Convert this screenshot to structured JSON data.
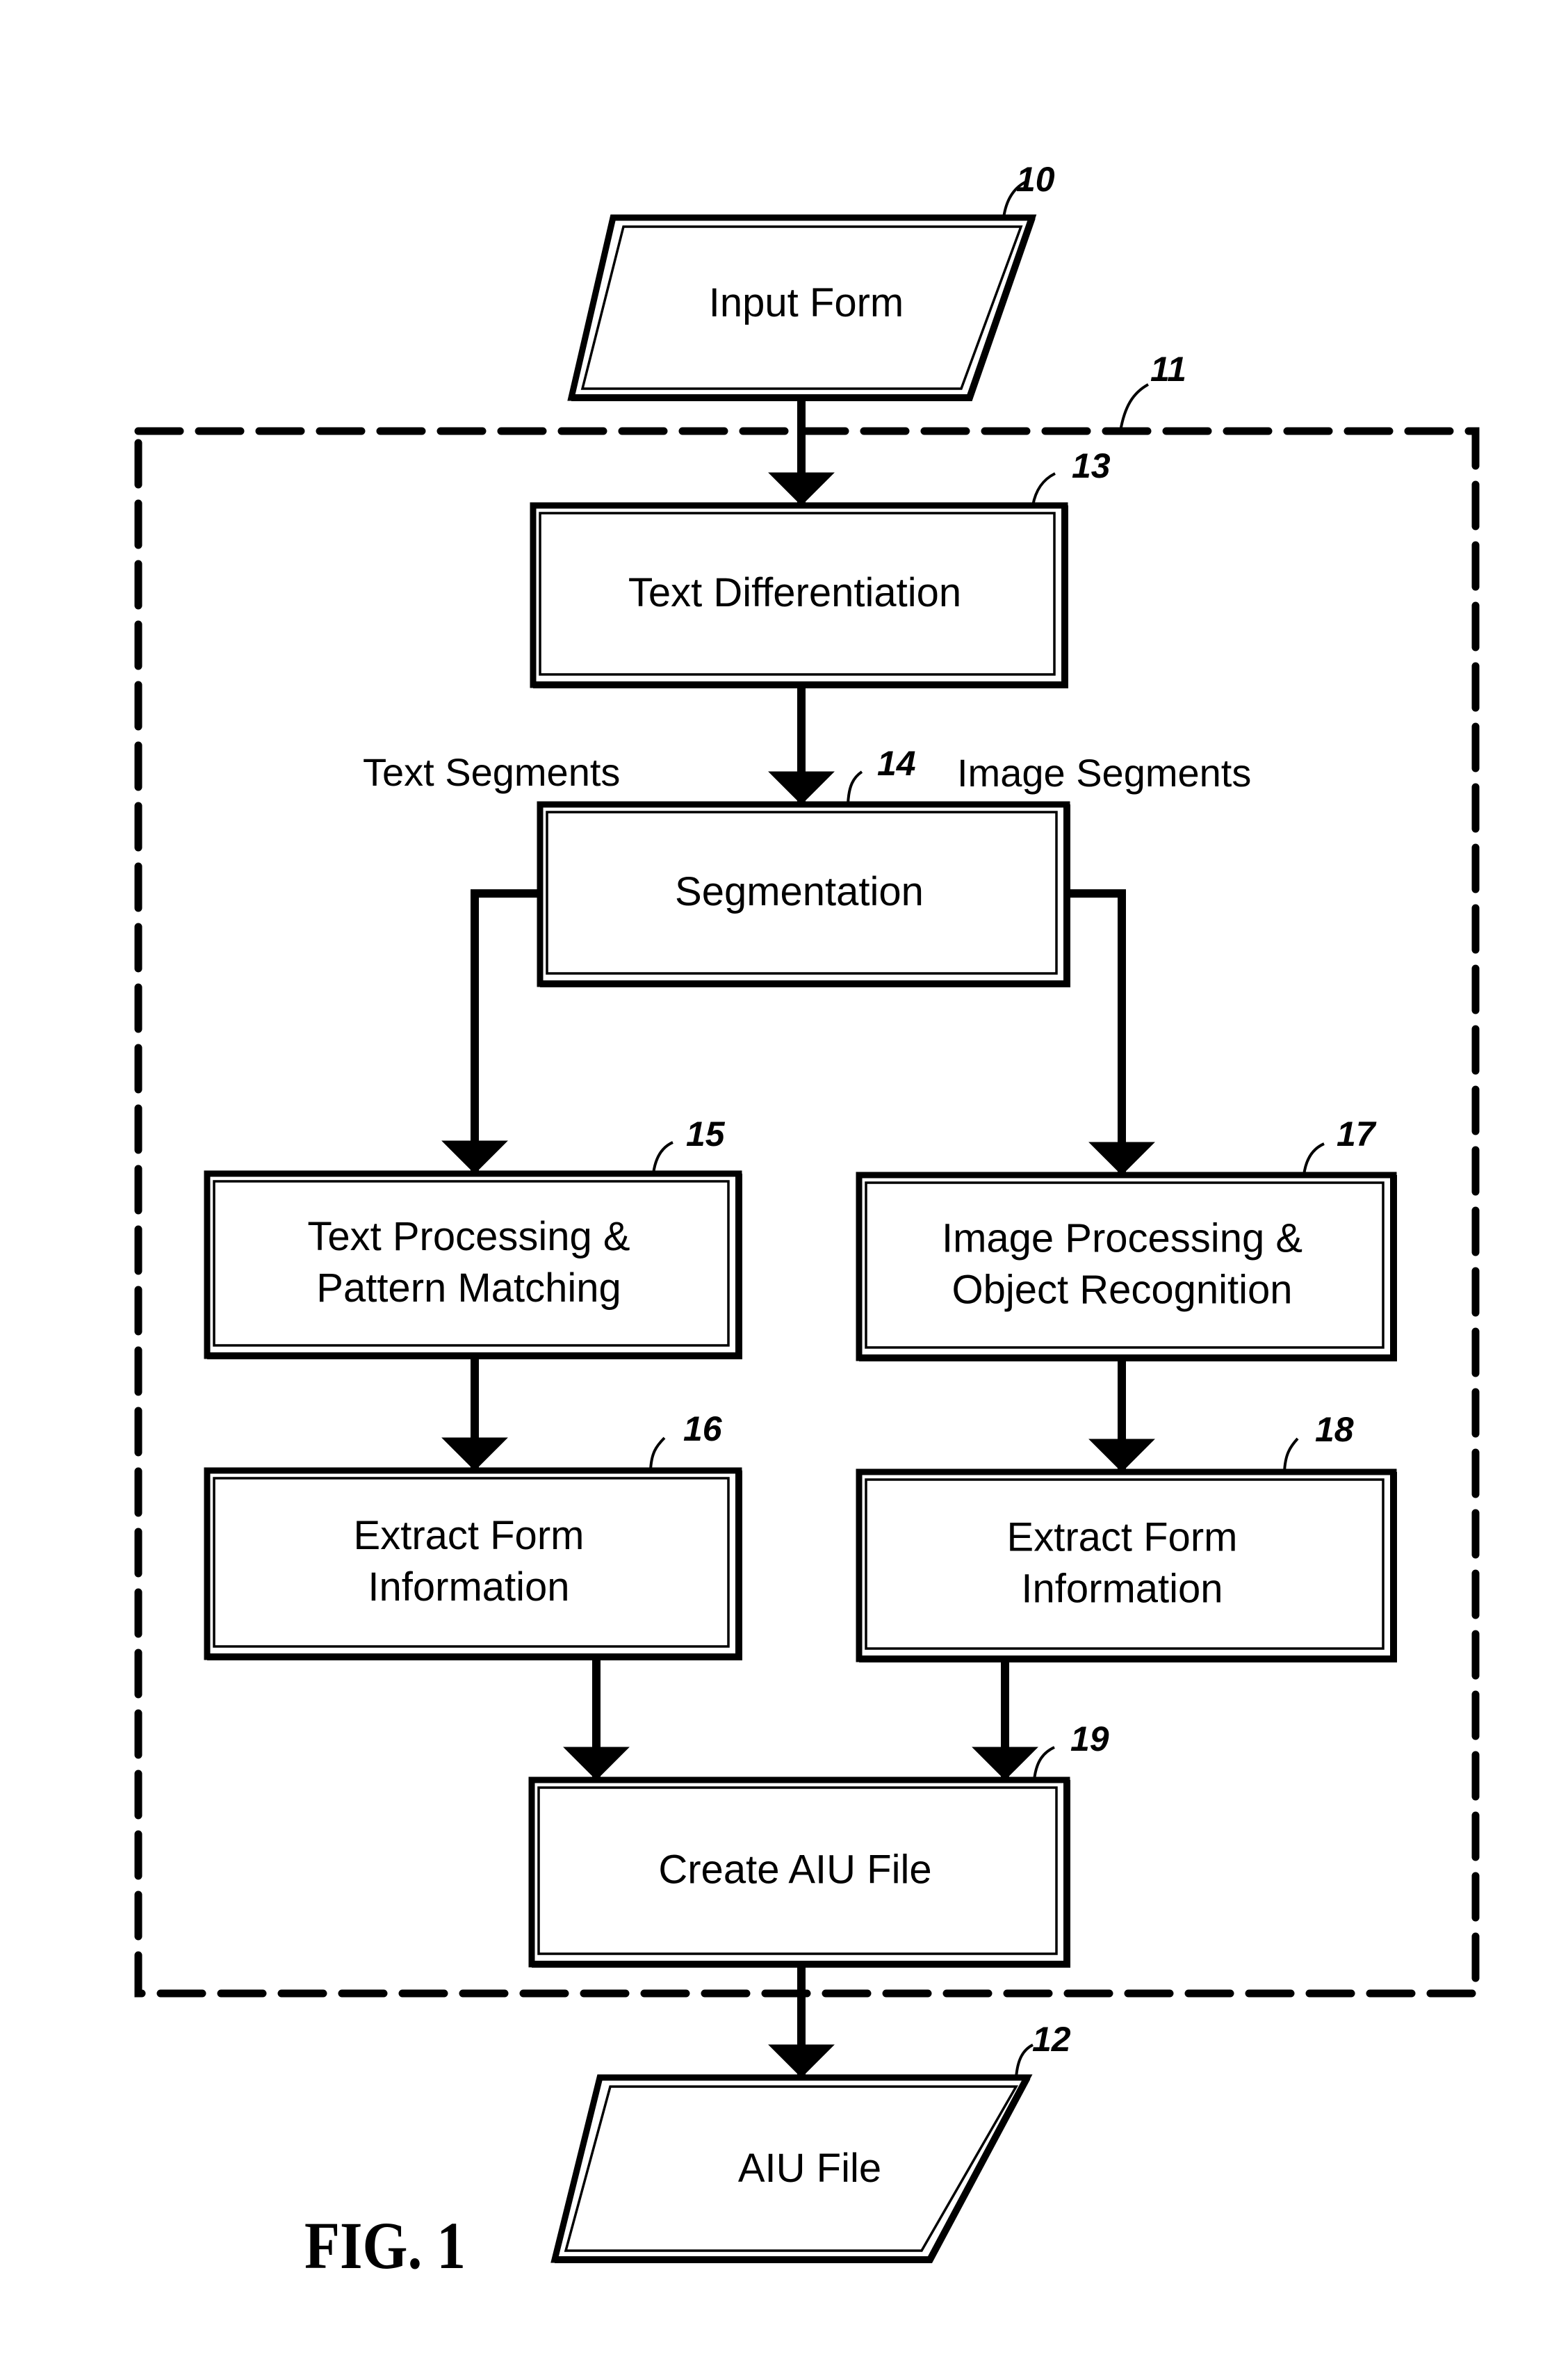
{
  "figure": {
    "caption": "FIG. 1",
    "frame": {
      "ref": "11"
    }
  },
  "nodes": [
    {
      "id": "input-form",
      "ref": "10",
      "shape": "parallelogram",
      "lines": [
        "Input Form"
      ]
    },
    {
      "id": "text-differentiation",
      "ref": "13",
      "shape": "box",
      "lines": [
        "Text Differentiation"
      ]
    },
    {
      "id": "segmentation",
      "ref": "14",
      "shape": "box",
      "lines": [
        "Segmentation"
      ]
    },
    {
      "id": "text-processing",
      "ref": "15",
      "shape": "box",
      "lines": [
        "Text Processing &",
        "Pattern Matching"
      ]
    },
    {
      "id": "extract-form-info-text",
      "ref": "16",
      "shape": "box",
      "lines": [
        "Extract Form",
        "Information"
      ]
    },
    {
      "id": "image-processing",
      "ref": "17",
      "shape": "box",
      "lines": [
        "Image Processing &",
        "Object Recognition"
      ]
    },
    {
      "id": "extract-form-info-image",
      "ref": "18",
      "shape": "box",
      "lines": [
        "Extract Form",
        "Information"
      ]
    },
    {
      "id": "create-aiu-file",
      "ref": "19",
      "shape": "box",
      "lines": [
        "Create AIU File"
      ]
    },
    {
      "id": "aiu-file",
      "ref": "12",
      "shape": "parallelogram",
      "lines": [
        "AIU File"
      ]
    }
  ],
  "edges": [
    {
      "from": "input-form",
      "to": "text-differentiation"
    },
    {
      "from": "text-differentiation",
      "to": "segmentation"
    },
    {
      "from": "segmentation",
      "to": "text-processing",
      "label": "Text Segments"
    },
    {
      "from": "segmentation",
      "to": "image-processing",
      "label": "Image Segments"
    },
    {
      "from": "text-processing",
      "to": "extract-form-info-text"
    },
    {
      "from": "image-processing",
      "to": "extract-form-info-image"
    },
    {
      "from": "extract-form-info-text",
      "to": "create-aiu-file"
    },
    {
      "from": "extract-form-info-image",
      "to": "create-aiu-file"
    },
    {
      "from": "create-aiu-file",
      "to": "aiu-file"
    }
  ],
  "colors": {
    "ink": "#000000",
    "paper": "#ffffff"
  }
}
